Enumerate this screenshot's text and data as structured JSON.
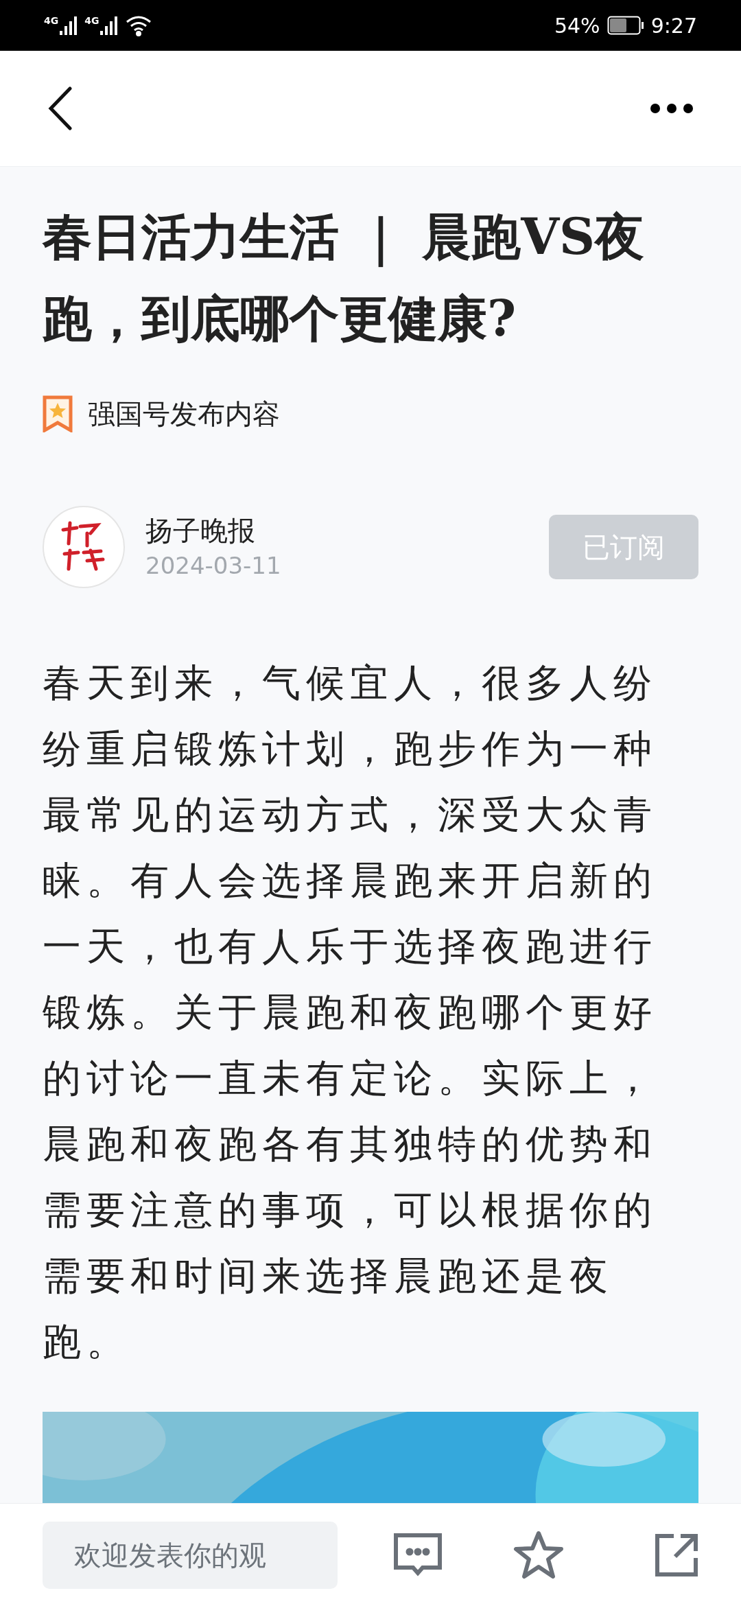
{
  "status_bar": {
    "network_1": "4G",
    "network_2": "4G",
    "battery": "54%",
    "time": "9:27"
  },
  "article": {
    "title": "春日活力生活 ｜ 晨跑VS夜跑，到底哪个更健康?",
    "source_label": "强国号发布内容",
    "author": {
      "name": "扬子晚报",
      "date": "2024-03-11",
      "subscribe": {
        "label": "已订阅",
        "subscribed": true
      }
    },
    "body": "春天到来，气候宜人，很多人纷纷重启锻炼计划，跑步作为一种最常见的运动方式，深受大众青睐。有人会选择晨跑来开启新的一天，也有人乐于选择夜跑进行锻炼。关于晨跑和夜跑哪个更好的讨论一直未有定论。实际上，晨跑和夜跑各有其独特的优势和需要注意的事项，可以根据你的需要和时间来选择晨跑还是夜跑。"
  },
  "bottom_bar": {
    "comment_placeholder": "欢迎发表你的观"
  }
}
